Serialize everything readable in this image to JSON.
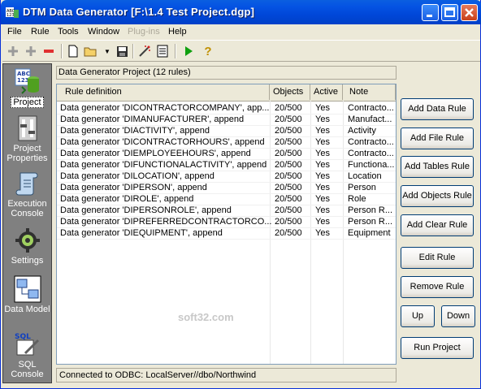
{
  "window": {
    "title": "DTM Data Generator [F:\\1.4 Test Project.dgp]"
  },
  "menu": [
    {
      "label": "File",
      "enabled": true
    },
    {
      "label": "Rule",
      "enabled": true
    },
    {
      "label": "Tools",
      "enabled": true
    },
    {
      "label": "Window",
      "enabled": true
    },
    {
      "label": "Plug-ins",
      "enabled": false
    },
    {
      "label": "Help",
      "enabled": true
    }
  ],
  "toolbar": [
    "add-rule-icon",
    "copy-rule-icon",
    "delete-rule-icon",
    "new-icon",
    "open-icon",
    "save-icon",
    "wizard-icon",
    "properties-icon",
    "run-icon",
    "help-icon"
  ],
  "sidebar": {
    "items": [
      {
        "label": "Project",
        "icon": "database-project-icon",
        "active": true
      },
      {
        "label": "Project Properties",
        "icon": "sliders-icon",
        "active": false
      },
      {
        "label": "Execution Console",
        "icon": "script-scroll-icon",
        "active": false
      },
      {
        "label": "Settings",
        "icon": "gear-settings-icon",
        "active": false
      },
      {
        "label": "Data Model",
        "icon": "data-model-icon",
        "active": false
      },
      {
        "label": "SQL Console",
        "icon": "sql-console-icon",
        "active": false
      }
    ]
  },
  "project": {
    "header": "Data Generator Project (12 rules)"
  },
  "table": {
    "columns": [
      "Rule definition",
      "Objects",
      "Active",
      "Note"
    ],
    "rows": [
      [
        "Data generator 'DICONTRACTORCOMPANY', app...",
        "20/500",
        "Yes",
        "Contracto..."
      ],
      [
        "Data generator 'DIMANUFACTURER', append",
        "20/500",
        "Yes",
        "Manufact..."
      ],
      [
        "Data generator 'DIACTIVITY', append",
        "20/500",
        "Yes",
        "Activity"
      ],
      [
        "Data generator 'DICONTRACTORHOURS', append",
        "20/500",
        "Yes",
        "Contracto..."
      ],
      [
        "Data generator 'DIEMPLOYEEHOURS', append",
        "20/500",
        "Yes",
        "Contracto..."
      ],
      [
        "Data generator 'DIFUNCTIONALACTIVITY', append",
        "20/500",
        "Yes",
        "Functiona..."
      ],
      [
        "Data generator 'DILOCATION', append",
        "20/500",
        "Yes",
        "Location"
      ],
      [
        "Data generator 'DIPERSON', append",
        "20/500",
        "Yes",
        "Person"
      ],
      [
        "Data generator 'DIROLE', append",
        "20/500",
        "Yes",
        "Role"
      ],
      [
        "Data generator 'DIPERSONROLE', append",
        "20/500",
        "Yes",
        "Person R..."
      ],
      [
        "Data generator 'DIPREFERREDCONTRACTORCO...",
        "20/500",
        "Yes",
        "Person R..."
      ],
      [
        "Data generator 'DIEQUIPMENT', append",
        "20/500",
        "Yes",
        "Equipment"
      ]
    ]
  },
  "buttons": {
    "add_data_rule": "Add Data Rule",
    "add_file_rule": "Add File Rule",
    "add_tables_rule": "Add Tables Rule",
    "add_objects_rule": "Add Objects Rule",
    "add_clear_rule": "Add Clear Rule",
    "edit_rule": "Edit Rule",
    "remove_rule": "Remove Rule",
    "up": "Up",
    "down": "Down",
    "run_project": "Run Project"
  },
  "status": {
    "text": "Connected to  ODBC: LocalServer//dbo/Northwind"
  },
  "watermark": "soft32.com"
}
